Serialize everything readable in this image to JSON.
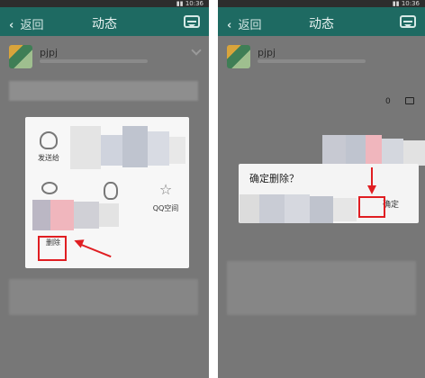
{
  "left": {
    "nav": {
      "back_label": "返回",
      "title": "动态"
    },
    "post": {
      "username": "pjpj"
    },
    "share_sheet": {
      "items": [
        {
          "label": "发送给",
          "icon": "contact-icon"
        },
        {
          "label": "",
          "icon": "weibo-icon"
        },
        {
          "label": "",
          "icon": "qq-icon"
        },
        {
          "label": "QQ空间",
          "icon": "qzone-star-icon"
        },
        {
          "label": "删除",
          "icon": "delete-icon"
        }
      ]
    }
  },
  "right": {
    "nav": {
      "back_label": "返回",
      "title": "动态"
    },
    "post": {
      "username": "pjpj",
      "counter": "0"
    },
    "dialog": {
      "title": "确定删除？",
      "ok_label": "确定"
    }
  },
  "colors": {
    "header": "#1e6a62",
    "highlight": "#e01e22",
    "overlay": "#7c7c7c"
  }
}
